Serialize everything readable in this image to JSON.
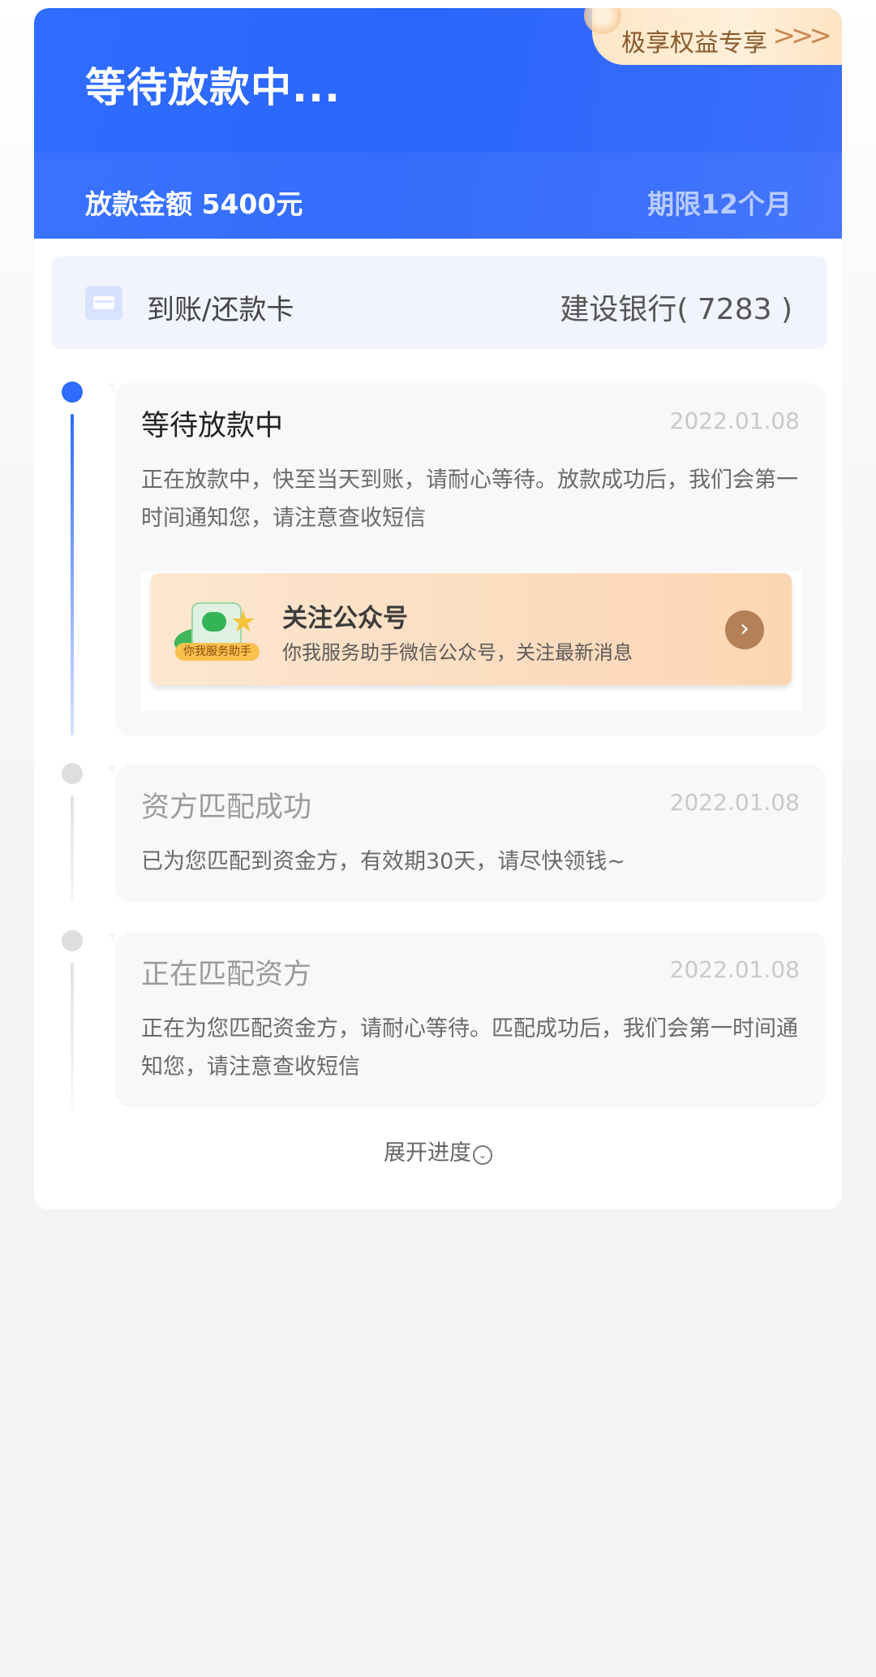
{
  "hero": {
    "title": "等待放款中...",
    "amount": "放款金额 5400元",
    "term": "期限12个月",
    "perk_label": "极享权益专享",
    "perk_arrows": ">>>"
  },
  "bank": {
    "label": "到账/还款卡",
    "value": "建设银行( 7283 )"
  },
  "steps": [
    {
      "title": "等待放款中",
      "date": "2022.01.08",
      "desc": "正在放款中，快至当天到账，请耐心等待。放款成功后，我们会第一时间通知您，请注意查收短信"
    },
    {
      "title": "资方匹配成功",
      "date": "2022.01.08",
      "desc": "已为您匹配到资金方，有效期30天，请尽快领钱~"
    },
    {
      "title": "正在匹配资方",
      "date": "2022.01.08",
      "desc": "正在为您匹配资金方，请耐心等待。匹配成功后，我们会第一时间通知您，请注意查收短信"
    }
  ],
  "follow": {
    "title": "关注公众号",
    "subtitle": "你我服务助手微信公众号，关注最新消息",
    "badge_text": "你我服务助手",
    "button": "›"
  },
  "expand": {
    "label": "展开进度",
    "icon": "⌄"
  },
  "colors": {
    "primary": "#2f6cff",
    "active_dot": "#2f6cff",
    "inactive_dot": "#dedede"
  }
}
